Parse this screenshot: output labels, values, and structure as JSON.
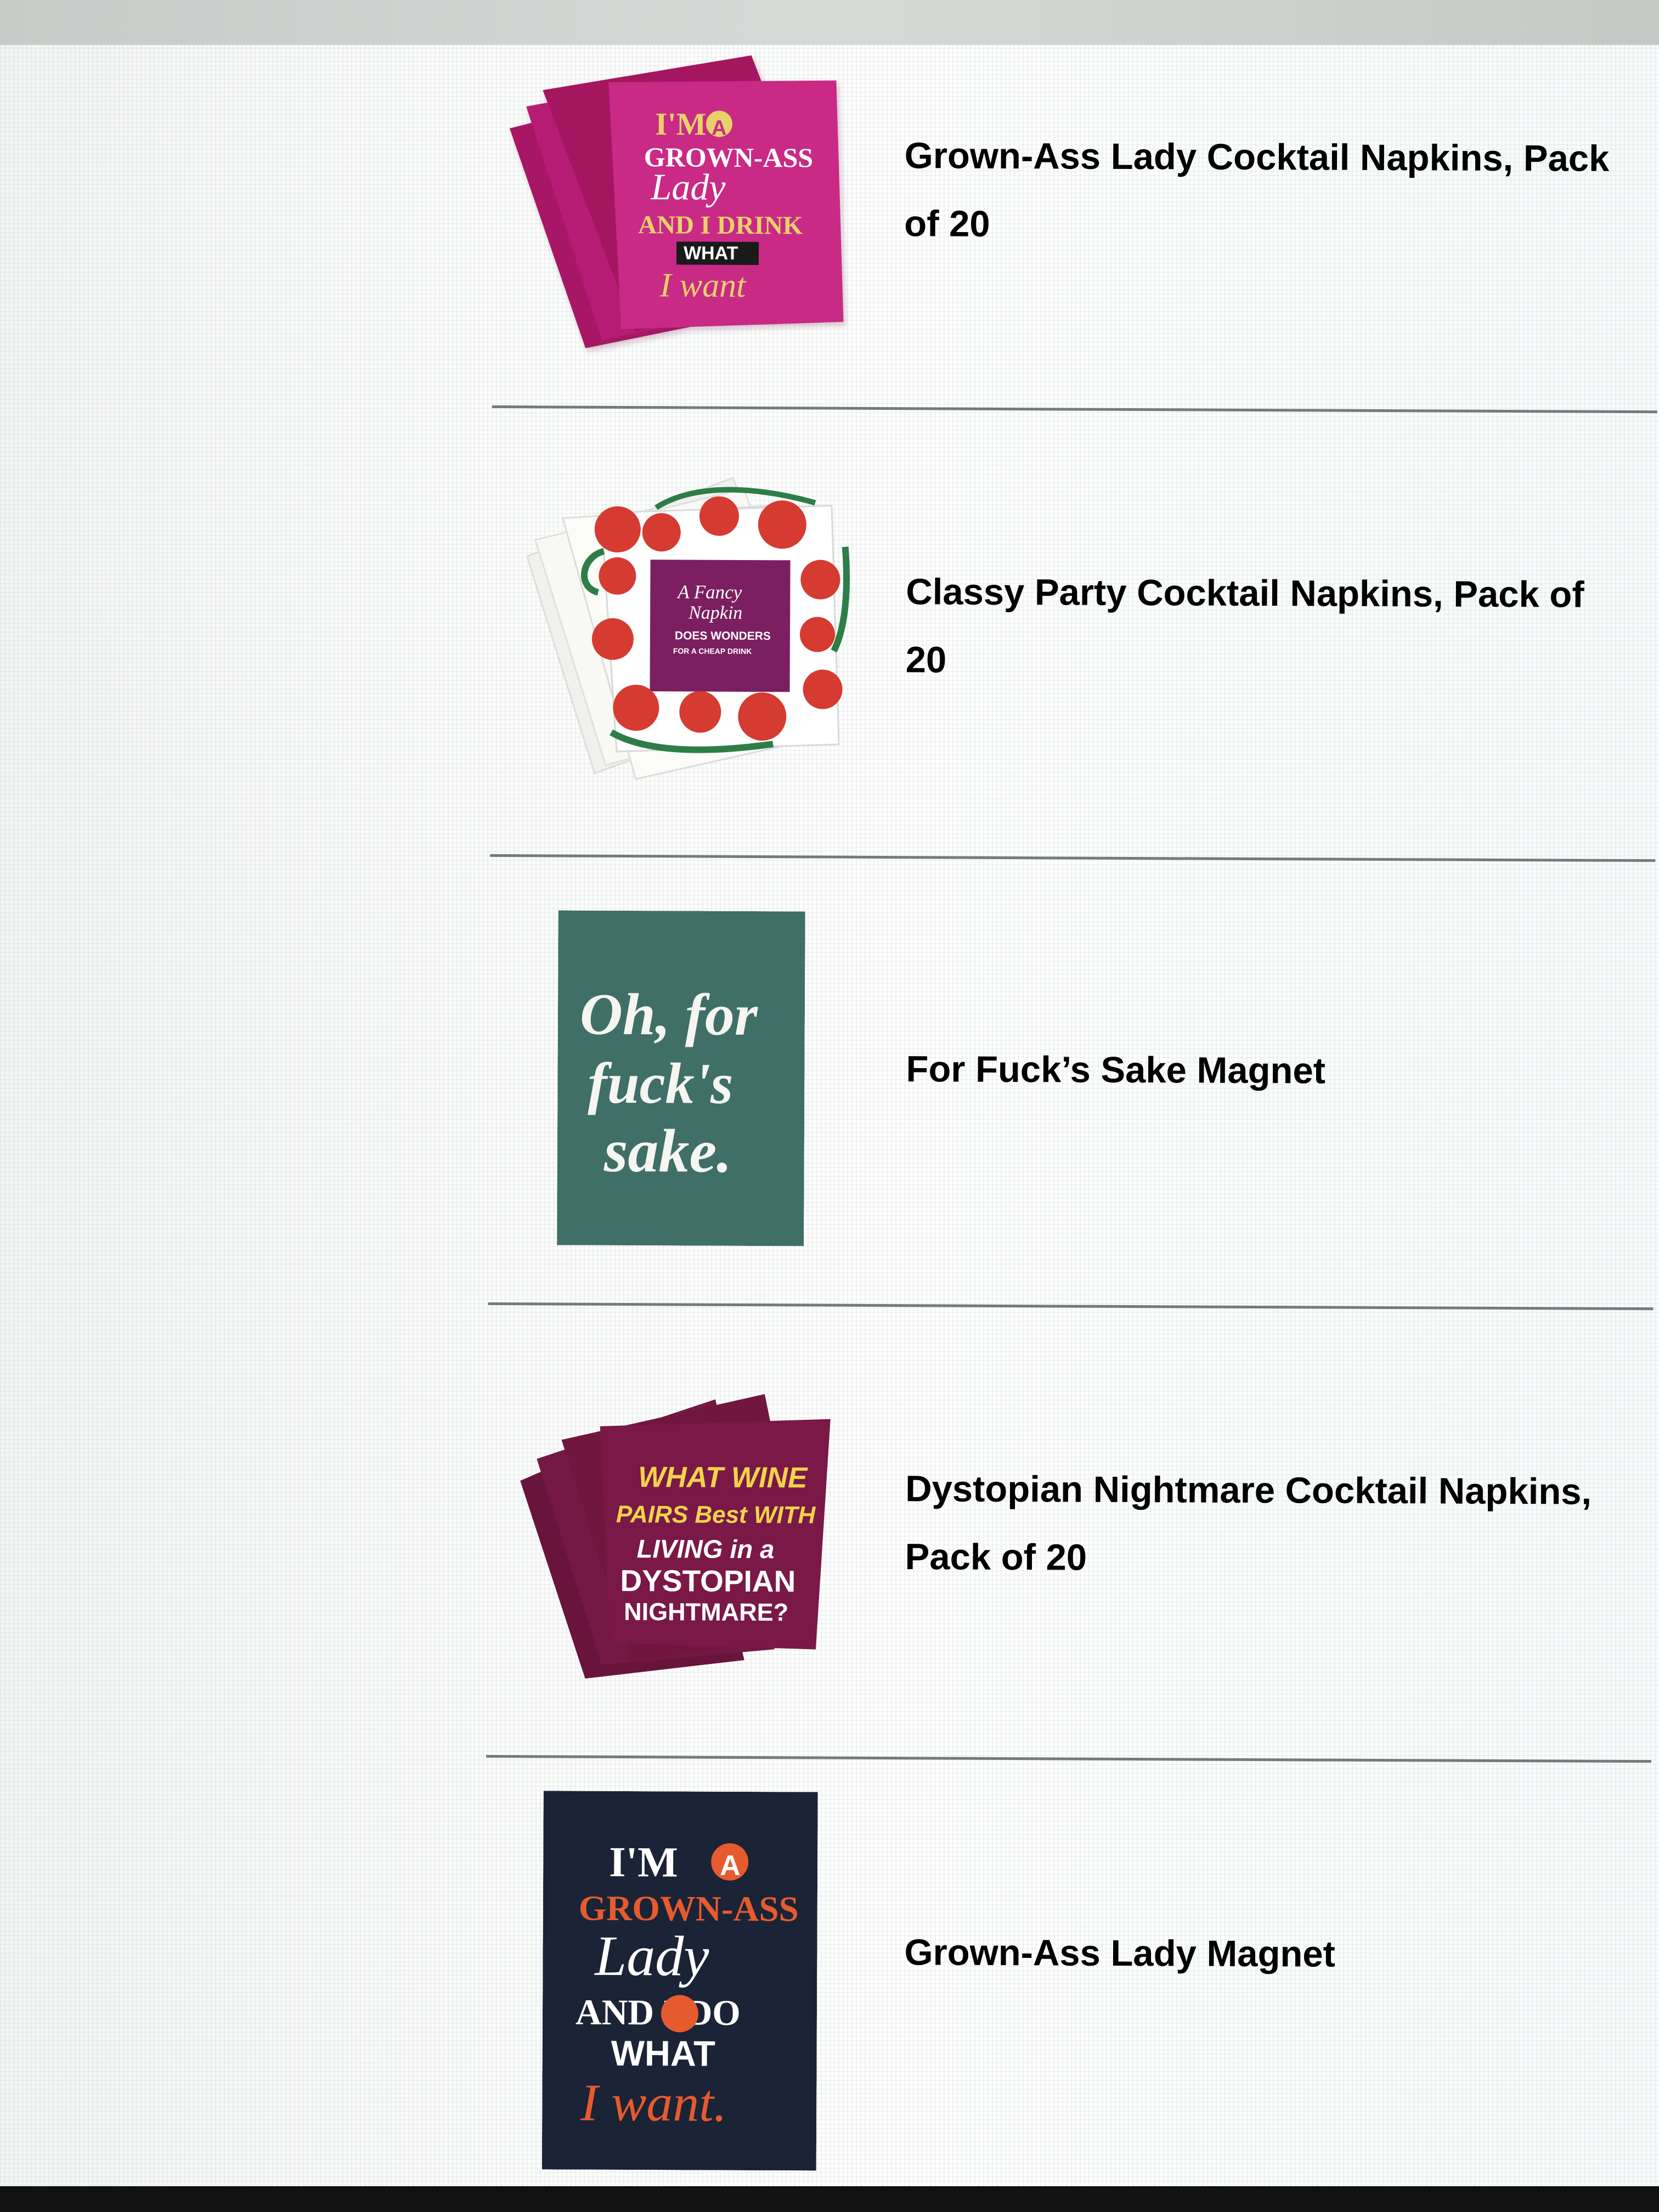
{
  "products": [
    {
      "title": "Grown-Ass Lady Cocktail Napkins, Pack of 20",
      "image_text": [
        "I'M",
        "A",
        "GROWN-ASS",
        "Lady",
        "AND I DRINK",
        "WHAT",
        "I want"
      ],
      "colors": {
        "primary": "#c32b82",
        "accent": "#e8d16a",
        "text": "#ffffff"
      }
    },
    {
      "title": "Classy Party Cocktail Napkins, Pack of 20",
      "image_text": [
        "A Fancy",
        "Napkin",
        "DOES WONDERS",
        "FOR A CHEAP DRINK"
      ],
      "colors": {
        "primary": "#ffffff",
        "accent": "#d63b31",
        "center": "#7b1f60"
      }
    },
    {
      "title": "For Fuck’s Sake Magnet",
      "image_text": [
        "Oh, for",
        "fuck's",
        "sake."
      ],
      "colors": {
        "primary": "#3f6f66",
        "text": "#f5f5f2"
      }
    },
    {
      "title": "Dystopian Nightmare Cocktail Napkins, Pack of 20",
      "image_text": [
        "WHAT WINE",
        "PAIRS Best WITH",
        "LIVING in a",
        "DYSTOPIAN",
        "NIGHTMARE?"
      ],
      "colors": {
        "primary": "#7a1848",
        "accent": "#f0d34b",
        "text": "#ffffff"
      }
    },
    {
      "title": "Grown-Ass Lady Magnet",
      "image_text": [
        "I'M",
        "A",
        "GROWN-ASS",
        "Lady",
        "AND I DO",
        "WHAT",
        "I want."
      ],
      "colors": {
        "primary": "#1b2336",
        "accent": "#e65b2e",
        "text": "#ffffff"
      }
    }
  ]
}
